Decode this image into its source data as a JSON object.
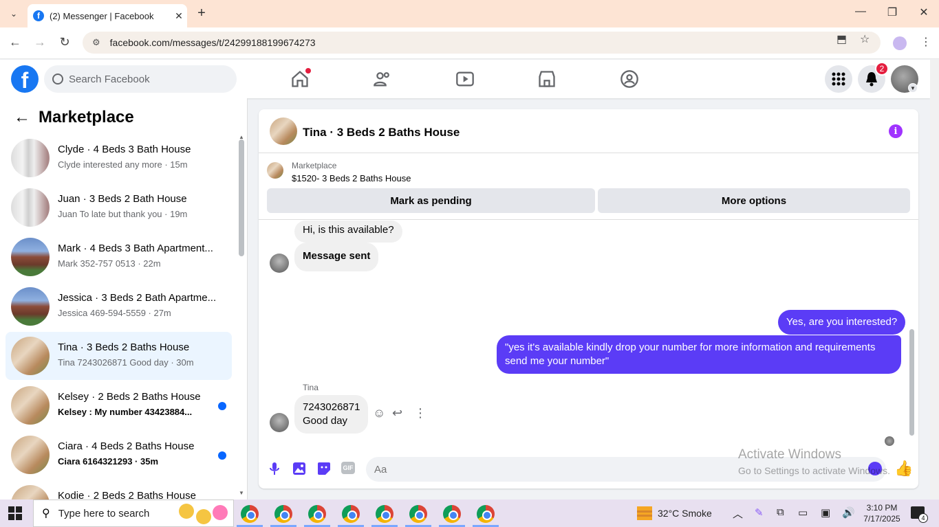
{
  "browser": {
    "tab_title": "(2) Messenger | Facebook",
    "url": "facebook.com/messages/t/24299188199674273"
  },
  "header": {
    "search_placeholder": "Search Facebook",
    "notification_count": "2",
    "brand_color": "#1877f2"
  },
  "sidebar": {
    "title": "Marketplace",
    "conversations": [
      {
        "name": "Clyde · 4 Beds 3 Bath House",
        "snippet": "Clyde interested any more · 15m",
        "thumb": "hall",
        "unread": false,
        "active": false
      },
      {
        "name": "Juan · 3 Beds 2 Bath House",
        "snippet": "Juan To late but thank you · 19m",
        "thumb": "hall",
        "unread": false,
        "active": false
      },
      {
        "name": "Mark · 4 Beds 3 Bath Apartment...",
        "snippet": "Mark 352-757 0513 · 22m",
        "thumb": "apt",
        "unread": false,
        "active": false
      },
      {
        "name": "Jessica · 3 Beds 2 Bath Apartme...",
        "snippet": "Jessica 469-594-5559 · 27m",
        "thumb": "apt",
        "unread": false,
        "active": false
      },
      {
        "name": "Tina · 3 Beds 2 Baths House",
        "snippet": "Tina 7243026871 Good day · 30m",
        "thumb": "house",
        "unread": false,
        "active": true
      },
      {
        "name": "Kelsey · 2 Beds 2 Baths House",
        "snippet": "Kelsey : My number 43423884...",
        "thumb": "house",
        "unread": true,
        "active": false
      },
      {
        "name": "Ciara · 4 Beds 2 Baths House",
        "snippet": "Ciara 6164321293 · 35m",
        "thumb": "house",
        "unread": true,
        "active": false
      },
      {
        "name": "Kodie · 2 Beds 2 Baths House",
        "snippet": "",
        "thumb": "house",
        "unread": false,
        "active": false
      }
    ]
  },
  "chat": {
    "title": "Tina · 3 Beds 2 Baths House",
    "marketplace_label": "Marketplace",
    "listing": "$1520- 3 Beds 2 Baths House",
    "mark_pending": "Mark as pending",
    "more_options": "More options",
    "messages": {
      "m1": "Hi, is this available?",
      "m2": "Message sent",
      "m3": "Yes, are you interested?",
      "m4_line1": "\"yes it's available kindly drop your number for more information and requirements",
      "m4_line2": "send me your number\"",
      "sender": "Tina",
      "m5_line1": "7243026871",
      "m5_line2": "Good day"
    },
    "input_placeholder": "Aa",
    "accent_color": "#5b3cf6"
  },
  "watermark": {
    "line1": "Activate Windows",
    "line2": "Go to Settings to activate Windows."
  },
  "taskbar": {
    "search_placeholder": "Type here to search",
    "weather": "32°C  Smoke",
    "time": "3:10 PM",
    "date": "7/17/2025",
    "notification_count": "4"
  }
}
